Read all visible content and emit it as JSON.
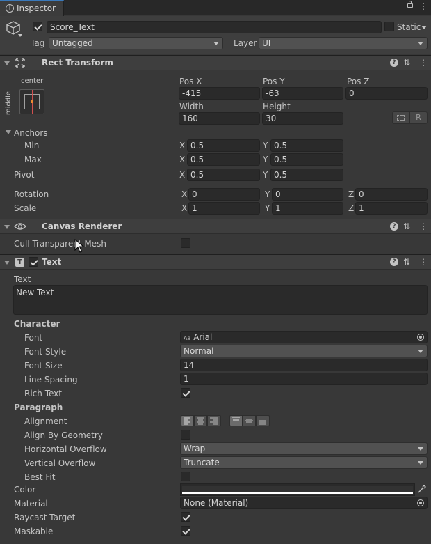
{
  "tab": {
    "title": "Inspector"
  },
  "object": {
    "name": "Score_Text",
    "static_label": "Static",
    "tag_label": "Tag",
    "tag_value": "Untagged",
    "layer_label": "Layer",
    "layer_value": "UI"
  },
  "rect_transform": {
    "title": "Rect Transform",
    "anchor_h": "center",
    "anchor_v": "middle",
    "posx_label": "Pos X",
    "posx": "-415",
    "posy_label": "Pos Y",
    "posy": "-63",
    "posz_label": "Pos Z",
    "posz": "0",
    "width_label": "Width",
    "width": "160",
    "height_label": "Height",
    "height": "30",
    "r_label": "R",
    "anchors_label": "Anchors",
    "min_label": "Min",
    "min_x": "0.5",
    "min_y": "0.5",
    "max_label": "Max",
    "max_x": "0.5",
    "max_y": "0.5",
    "pivot_label": "Pivot",
    "pivot_x": "0.5",
    "pivot_y": "0.5",
    "rotation_label": "Rotation",
    "rot_x": "0",
    "rot_y": "0",
    "rot_z": "0",
    "scale_label": "Scale",
    "scale_x": "1",
    "scale_y": "1",
    "scale_z": "1",
    "x": "X",
    "y": "Y",
    "z": "Z"
  },
  "canvas_renderer": {
    "title": "Canvas Renderer",
    "cull_label": "Cull Transparent Mesh"
  },
  "text_component": {
    "title": "Text",
    "text_label": "Text",
    "text_value": "New Text",
    "character_label": "Character",
    "font_label": "Font",
    "font_prefix": "Aa",
    "font_value": "Arial",
    "font_style_label": "Font Style",
    "font_style_value": "Normal",
    "font_size_label": "Font Size",
    "font_size_value": "14",
    "line_spacing_label": "Line Spacing",
    "line_spacing_value": "1",
    "rich_text_label": "Rich Text",
    "paragraph_label": "Paragraph",
    "alignment_label": "Alignment",
    "align_geometry_label": "Align By Geometry",
    "h_overflow_label": "Horizontal Overflow",
    "h_overflow_value": "Wrap",
    "v_overflow_label": "Vertical Overflow",
    "v_overflow_value": "Truncate",
    "best_fit_label": "Best Fit",
    "color_label": "Color",
    "material_label": "Material",
    "material_value": "None (Material)",
    "raycast_label": "Raycast Target",
    "maskable_label": "Maskable"
  }
}
